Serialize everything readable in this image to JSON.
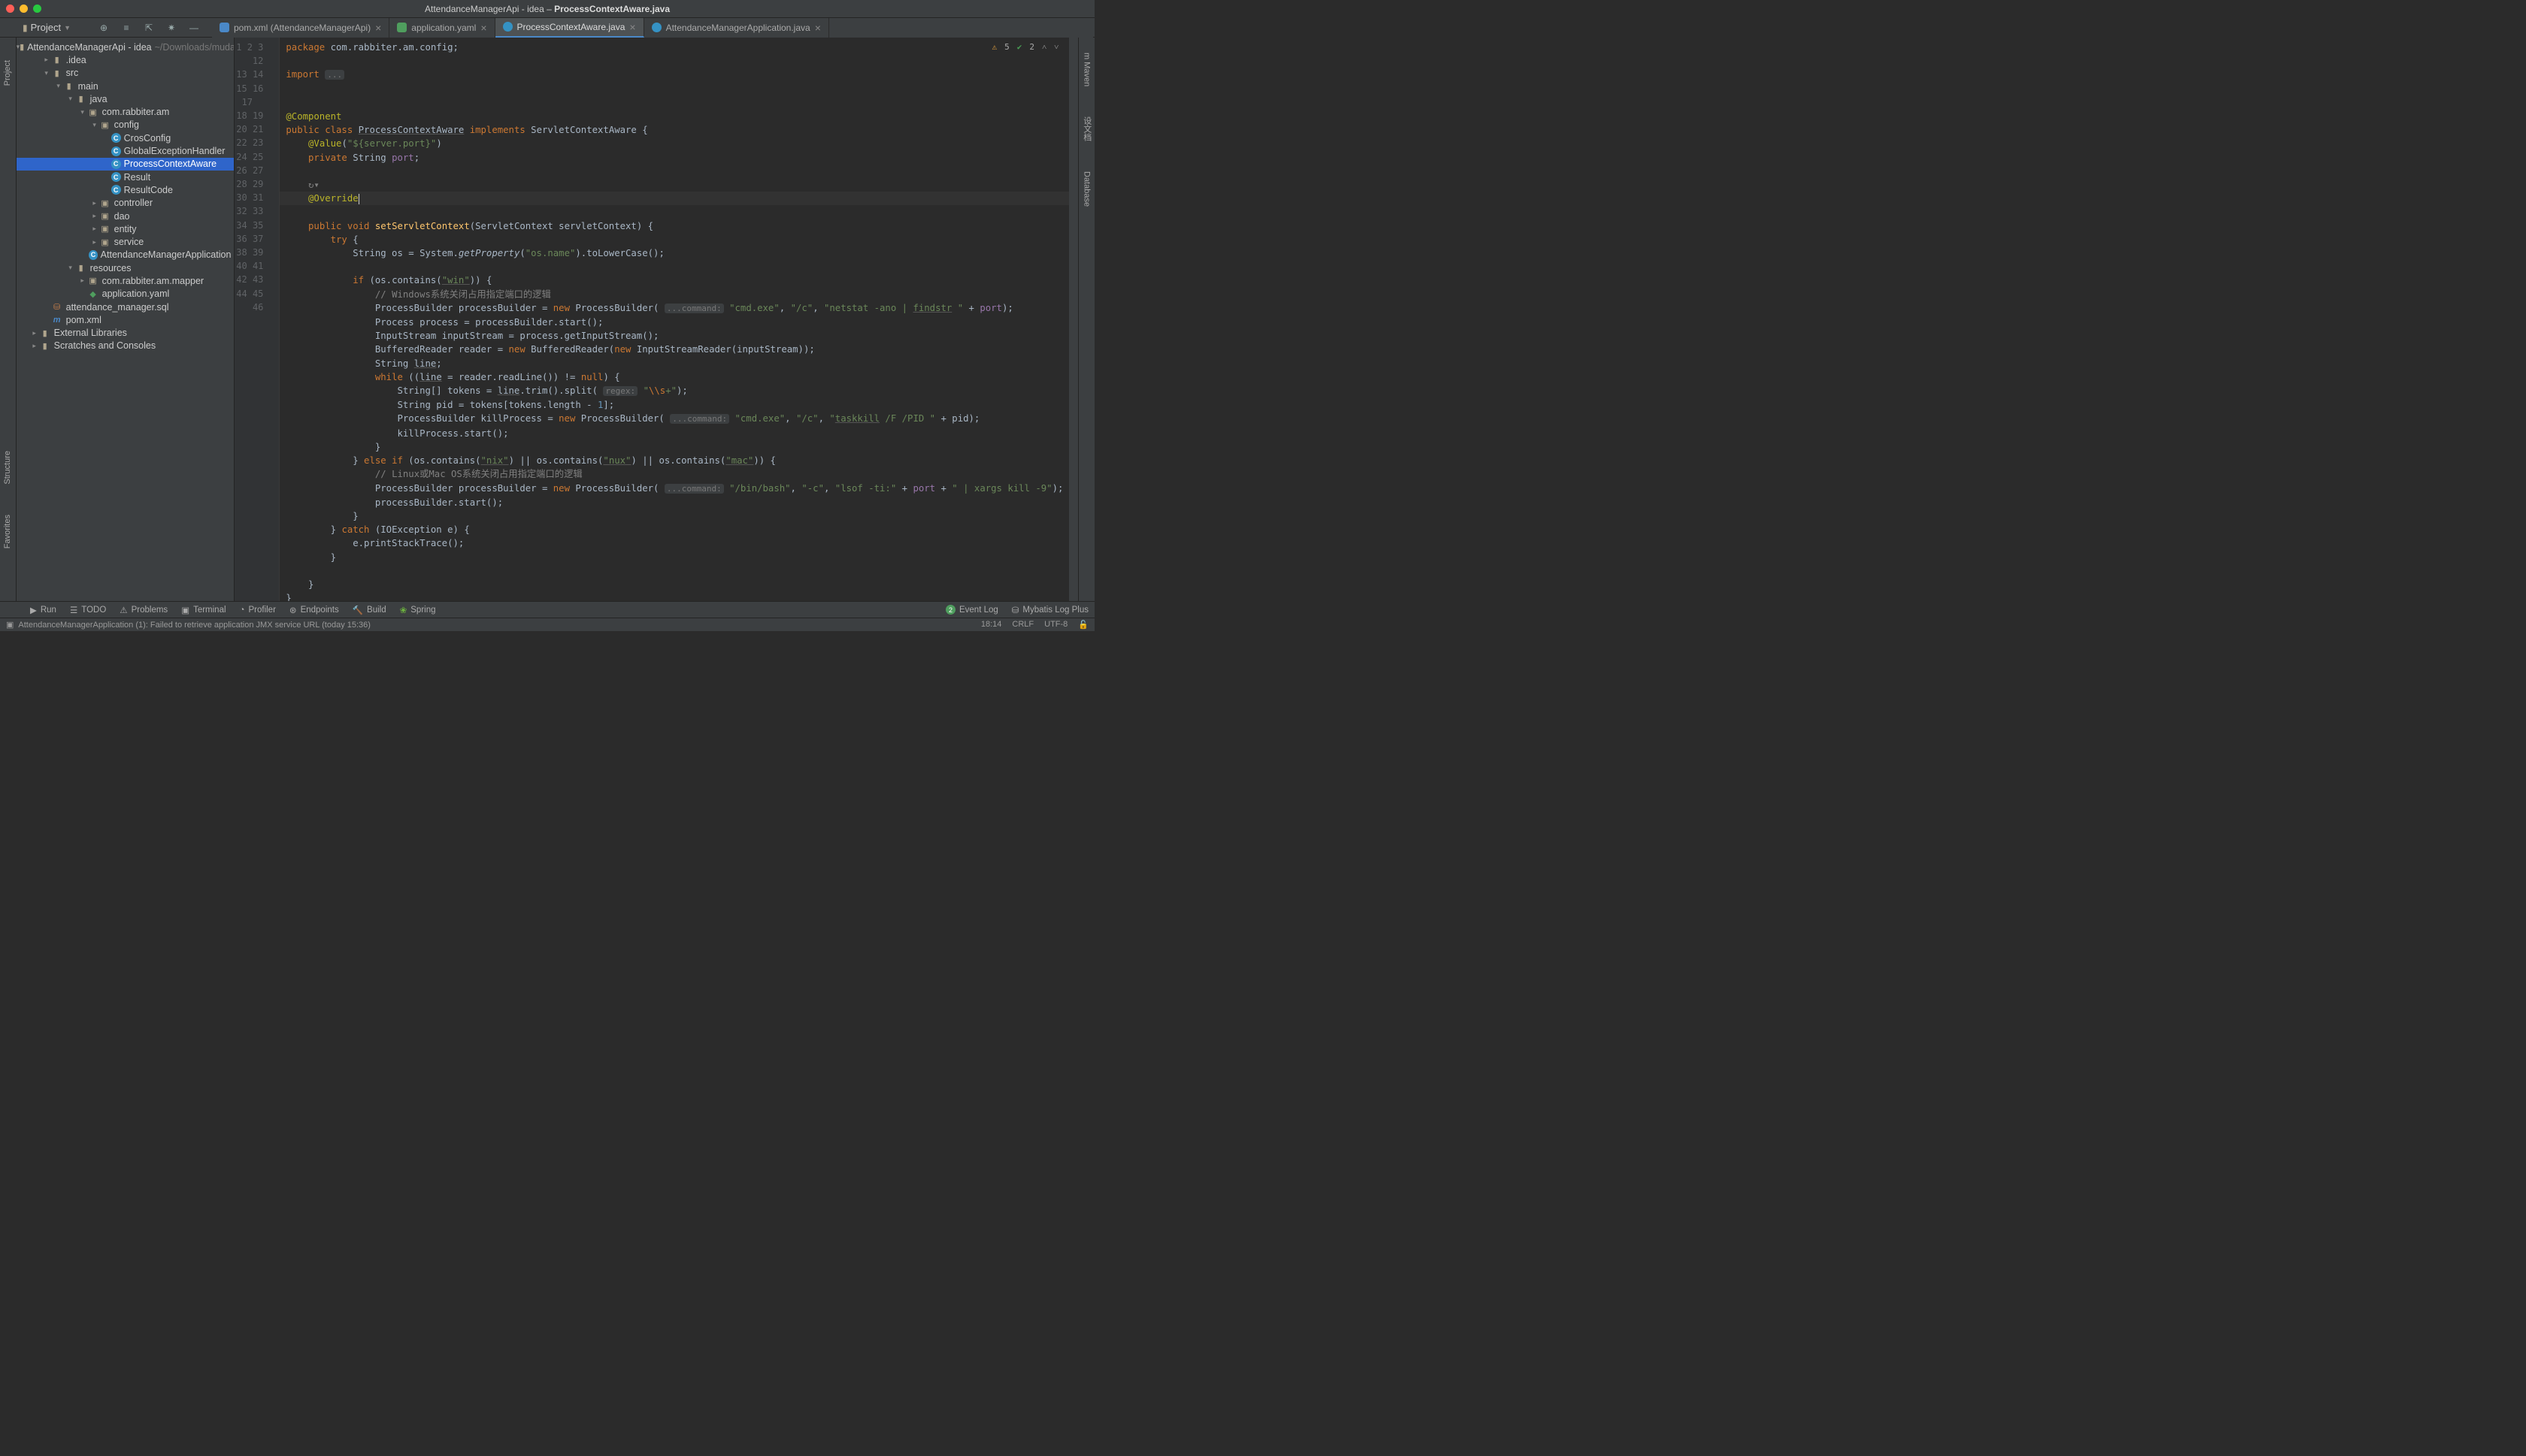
{
  "window": {
    "title_app": "AttendanceManagerApi - idea",
    "title_file": "ProcessContextAware.java"
  },
  "project_toolbar": {
    "label": "Project"
  },
  "tabs": [
    {
      "label": "pom.xml (AttendanceManagerApi)",
      "type": "m",
      "active": false
    },
    {
      "label": "application.yaml",
      "type": "yaml",
      "active": false
    },
    {
      "label": "ProcessContextAware.java",
      "type": "java",
      "active": true
    },
    {
      "label": "AttendanceManagerApplication.java",
      "type": "java",
      "active": false
    }
  ],
  "left_tabs": [
    "Project"
  ],
  "left_tabs_bottom": [
    "Structure",
    "Favorites"
  ],
  "right_tabs": [
    "m Maven",
    "设文档",
    "Database"
  ],
  "tree": [
    {
      "depth": 0,
      "arrow": "▾",
      "icon": "folder",
      "label": "AttendanceManagerApi - idea",
      "dim": "~/Downloads/mudai"
    },
    {
      "depth": 1,
      "arrow": "▸",
      "icon": "folder",
      "label": ".idea"
    },
    {
      "depth": 1,
      "arrow": "▾",
      "icon": "folder",
      "label": "src"
    },
    {
      "depth": 2,
      "arrow": "▾",
      "icon": "folder",
      "label": "main"
    },
    {
      "depth": 3,
      "arrow": "▾",
      "icon": "folder",
      "label": "java"
    },
    {
      "depth": 4,
      "arrow": "▾",
      "icon": "pkg",
      "label": "com.rabbiter.am"
    },
    {
      "depth": 5,
      "arrow": "▾",
      "icon": "pkg",
      "label": "config"
    },
    {
      "depth": 6,
      "arrow": "",
      "icon": "class",
      "label": "CrosConfig"
    },
    {
      "depth": 6,
      "arrow": "",
      "icon": "class",
      "label": "GlobalExceptionHandler"
    },
    {
      "depth": 6,
      "arrow": "",
      "icon": "class",
      "label": "ProcessContextAware",
      "selected": true
    },
    {
      "depth": 6,
      "arrow": "",
      "icon": "class",
      "label": "Result"
    },
    {
      "depth": 6,
      "arrow": "",
      "icon": "class",
      "label": "ResultCode"
    },
    {
      "depth": 5,
      "arrow": "▸",
      "icon": "pkg",
      "label": "controller"
    },
    {
      "depth": 5,
      "arrow": "▸",
      "icon": "pkg",
      "label": "dao"
    },
    {
      "depth": 5,
      "arrow": "▸",
      "icon": "pkg",
      "label": "entity"
    },
    {
      "depth": 5,
      "arrow": "▸",
      "icon": "pkg",
      "label": "service"
    },
    {
      "depth": 5,
      "arrow": "",
      "icon": "class",
      "label": "AttendanceManagerApplication"
    },
    {
      "depth": 3,
      "arrow": "▾",
      "icon": "folder",
      "label": "resources"
    },
    {
      "depth": 4,
      "arrow": "▸",
      "icon": "pkg",
      "label": "com.rabbiter.am.mapper"
    },
    {
      "depth": 4,
      "arrow": "",
      "icon": "yaml",
      "label": "application.yaml"
    },
    {
      "depth": 1,
      "arrow": "",
      "icon": "sql",
      "label": "attendance_manager.sql"
    },
    {
      "depth": 1,
      "arrow": "",
      "icon": "xml",
      "label": "pom.xml"
    },
    {
      "depth": 0,
      "arrow": "▸",
      "icon": "folder",
      "label": "External Libraries"
    },
    {
      "depth": 0,
      "arrow": "▸",
      "icon": "folder",
      "label": "Scratches and Consoles"
    }
  ],
  "code_lines": [
    {
      "n": 1,
      "html": "<span class='kw'>package</span> com.rabbiter.am.config;"
    },
    {
      "n": 2,
      "html": ""
    },
    {
      "n": 3,
      "html": "<span class='kw'>import</span> <span class='hint'>...</span>"
    },
    {
      "n": "",
      "html": ""
    },
    {
      "n": 12,
      "html": ""
    },
    {
      "n": 13,
      "html": "<span class='ann'>@Component</span>"
    },
    {
      "n": 14,
      "html": "<span class='kw'>public class</span> <span class='und'>ProcessContextAware</span> <span class='kw'>implements</span> ServletContextAware {"
    },
    {
      "n": 15,
      "html": "    <span class='ann'>@Value</span>(<span class='str'>\"${server.port}\"</span>)"
    },
    {
      "n": 16,
      "html": "    <span class='kw'>private</span> String <span class='fld'>port</span>;"
    },
    {
      "n": 17,
      "html": ""
    },
    {
      "n": "",
      "html": "    <span class='cmt'>↻▾</span>"
    },
    {
      "n": 18,
      "html": "    <span class='ann'>@Override</span><span class='caret'></span>",
      "current": true
    },
    {
      "n": 19,
      "html": "    <span class='kw'>public void</span> <span class='mth'>setServletContext</span>(ServletContext servletContext) {"
    },
    {
      "n": 20,
      "html": "        <span class='kw'>try</span> {"
    },
    {
      "n": 21,
      "html": "            String os = System.<span style='font-style:italic'>getProperty</span>(<span class='str'>\"os.name\"</span>).toLowerCase();"
    },
    {
      "n": 22,
      "html": ""
    },
    {
      "n": 23,
      "html": "            <span class='kw'>if</span> (os.contains(<span class='str und'>\"win\"</span>)) {"
    },
    {
      "n": 24,
      "html": "                <span class='cmt'>// Windows系统关闭占用指定端口的逻辑</span>"
    },
    {
      "n": 25,
      "html": "                ProcessBuilder processBuilder = <span class='kw'>new</span> ProcessBuilder( <span class='hint'>...command:</span> <span class='str'>\"cmd.exe\"</span>, <span class='str'>\"/c\"</span>, <span class='str'>\"netstat -ano | <span class='und'>findstr</span> \"</span> + <span class='fld'>port</span>);"
    },
    {
      "n": 26,
      "html": "                Process process = processBuilder.start();"
    },
    {
      "n": 27,
      "html": "                InputStream inputStream = process.getInputStream();"
    },
    {
      "n": 28,
      "html": "                BufferedReader reader = <span class='kw'>new</span> BufferedReader(<span class='kw'>new</span> InputStreamReader(inputStream));"
    },
    {
      "n": 29,
      "html": "                String <span class='und'>line</span>;"
    },
    {
      "n": 30,
      "html": "                <span class='kw'>while</span> ((<span class='und'>line</span> = reader.readLine()) != <span class='kw'>null</span>) {"
    },
    {
      "n": 31,
      "html": "                    String[] tokens = <span class='und'>line</span>.trim().split( <span class='hint'>regex:</span> <span class='str'>\"<span style='color:#cc7832'>\\\\s</span>+\"</span>);"
    },
    {
      "n": 32,
      "html": "                    String pid = tokens[tokens.length - <span class='num'>1</span>];"
    },
    {
      "n": 33,
      "html": "                    ProcessBuilder killProcess = <span class='kw'>new</span> ProcessBuilder( <span class='hint'>...command:</span> <span class='str'>\"cmd.exe\"</span>, <span class='str'>\"/c\"</span>, <span class='str'>\"<span class='und'>taskkill</span> /F /PID \"</span> + pid);"
    },
    {
      "n": 34,
      "html": "                    killProcess.start();"
    },
    {
      "n": 35,
      "html": "                }"
    },
    {
      "n": 36,
      "html": "            } <span class='kw'>else if</span> (os.contains(<span class='str und'>\"nix\"</span>) || os.contains(<span class='str und'>\"nux\"</span>) || os.contains(<span class='str und'>\"mac\"</span>)) {"
    },
    {
      "n": 37,
      "html": "                <span class='cmt'>// Linux或Mac OS系统关闭占用指定端口的逻辑</span>"
    },
    {
      "n": 38,
      "html": "                ProcessBuilder processBuilder = <span class='kw'>new</span> ProcessBuilder( <span class='hint'>...command:</span> <span class='str'>\"/bin/bash\"</span>, <span class='str'>\"-c\"</span>, <span class='str'>\"lsof -ti:\"</span> + <span class='fld'>port</span> + <span class='str'>\" | xargs kill -9\"</span>);"
    },
    {
      "n": 39,
      "html": "                processBuilder.start();"
    },
    {
      "n": 40,
      "html": "            }"
    },
    {
      "n": 41,
      "html": "        } <span class='kw'>catch</span> (IOException e) {"
    },
    {
      "n": 42,
      "html": "            e.printStackTrace();"
    },
    {
      "n": 43,
      "html": "        }"
    },
    {
      "n": 44,
      "html": ""
    },
    {
      "n": 45,
      "html": "    }"
    },
    {
      "n": 46,
      "html": "}"
    }
  ],
  "inspections": {
    "warn_count": "5",
    "ok_count": "2"
  },
  "bottom_tools": {
    "run": "Run",
    "todo": "TODO",
    "problems": "Problems",
    "terminal": "Terminal",
    "profiler": "Profiler",
    "endpoints": "Endpoints",
    "build": "Build",
    "spring": "Spring",
    "event_log": "Event Log",
    "event_badge": "2",
    "mybatis": "Mybatis Log Plus"
  },
  "statusbar": {
    "message": "AttendanceManagerApplication (1): Failed to retrieve application JMX service URL (today 15:36)",
    "pos": "18:14",
    "sep": "CRLF",
    "enc": "UTF-8"
  }
}
